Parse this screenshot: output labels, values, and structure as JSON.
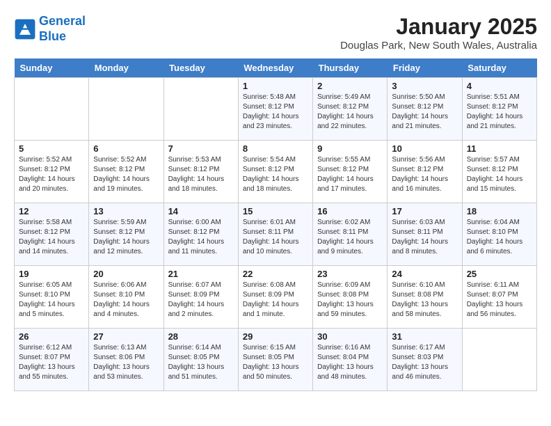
{
  "header": {
    "logo_line1": "General",
    "logo_line2": "Blue",
    "month": "January 2025",
    "location": "Douglas Park, New South Wales, Australia"
  },
  "weekdays": [
    "Sunday",
    "Monday",
    "Tuesday",
    "Wednesday",
    "Thursday",
    "Friday",
    "Saturday"
  ],
  "weeks": [
    [
      {
        "day": "",
        "info": ""
      },
      {
        "day": "",
        "info": ""
      },
      {
        "day": "",
        "info": ""
      },
      {
        "day": "1",
        "info": "Sunrise: 5:48 AM\nSunset: 8:12 PM\nDaylight: 14 hours\nand 23 minutes."
      },
      {
        "day": "2",
        "info": "Sunrise: 5:49 AM\nSunset: 8:12 PM\nDaylight: 14 hours\nand 22 minutes."
      },
      {
        "day": "3",
        "info": "Sunrise: 5:50 AM\nSunset: 8:12 PM\nDaylight: 14 hours\nand 21 minutes."
      },
      {
        "day": "4",
        "info": "Sunrise: 5:51 AM\nSunset: 8:12 PM\nDaylight: 14 hours\nand 21 minutes."
      }
    ],
    [
      {
        "day": "5",
        "info": "Sunrise: 5:52 AM\nSunset: 8:12 PM\nDaylight: 14 hours\nand 20 minutes."
      },
      {
        "day": "6",
        "info": "Sunrise: 5:52 AM\nSunset: 8:12 PM\nDaylight: 14 hours\nand 19 minutes."
      },
      {
        "day": "7",
        "info": "Sunrise: 5:53 AM\nSunset: 8:12 PM\nDaylight: 14 hours\nand 18 minutes."
      },
      {
        "day": "8",
        "info": "Sunrise: 5:54 AM\nSunset: 8:12 PM\nDaylight: 14 hours\nand 18 minutes."
      },
      {
        "day": "9",
        "info": "Sunrise: 5:55 AM\nSunset: 8:12 PM\nDaylight: 14 hours\nand 17 minutes."
      },
      {
        "day": "10",
        "info": "Sunrise: 5:56 AM\nSunset: 8:12 PM\nDaylight: 14 hours\nand 16 minutes."
      },
      {
        "day": "11",
        "info": "Sunrise: 5:57 AM\nSunset: 8:12 PM\nDaylight: 14 hours\nand 15 minutes."
      }
    ],
    [
      {
        "day": "12",
        "info": "Sunrise: 5:58 AM\nSunset: 8:12 PM\nDaylight: 14 hours\nand 14 minutes."
      },
      {
        "day": "13",
        "info": "Sunrise: 5:59 AM\nSunset: 8:12 PM\nDaylight: 14 hours\nand 12 minutes."
      },
      {
        "day": "14",
        "info": "Sunrise: 6:00 AM\nSunset: 8:12 PM\nDaylight: 14 hours\nand 11 minutes."
      },
      {
        "day": "15",
        "info": "Sunrise: 6:01 AM\nSunset: 8:11 PM\nDaylight: 14 hours\nand 10 minutes."
      },
      {
        "day": "16",
        "info": "Sunrise: 6:02 AM\nSunset: 8:11 PM\nDaylight: 14 hours\nand 9 minutes."
      },
      {
        "day": "17",
        "info": "Sunrise: 6:03 AM\nSunset: 8:11 PM\nDaylight: 14 hours\nand 8 minutes."
      },
      {
        "day": "18",
        "info": "Sunrise: 6:04 AM\nSunset: 8:10 PM\nDaylight: 14 hours\nand 6 minutes."
      }
    ],
    [
      {
        "day": "19",
        "info": "Sunrise: 6:05 AM\nSunset: 8:10 PM\nDaylight: 14 hours\nand 5 minutes."
      },
      {
        "day": "20",
        "info": "Sunrise: 6:06 AM\nSunset: 8:10 PM\nDaylight: 14 hours\nand 4 minutes."
      },
      {
        "day": "21",
        "info": "Sunrise: 6:07 AM\nSunset: 8:09 PM\nDaylight: 14 hours\nand 2 minutes."
      },
      {
        "day": "22",
        "info": "Sunrise: 6:08 AM\nSunset: 8:09 PM\nDaylight: 14 hours\nand 1 minute."
      },
      {
        "day": "23",
        "info": "Sunrise: 6:09 AM\nSunset: 8:08 PM\nDaylight: 13 hours\nand 59 minutes."
      },
      {
        "day": "24",
        "info": "Sunrise: 6:10 AM\nSunset: 8:08 PM\nDaylight: 13 hours\nand 58 minutes."
      },
      {
        "day": "25",
        "info": "Sunrise: 6:11 AM\nSunset: 8:07 PM\nDaylight: 13 hours\nand 56 minutes."
      }
    ],
    [
      {
        "day": "26",
        "info": "Sunrise: 6:12 AM\nSunset: 8:07 PM\nDaylight: 13 hours\nand 55 minutes."
      },
      {
        "day": "27",
        "info": "Sunrise: 6:13 AM\nSunset: 8:06 PM\nDaylight: 13 hours\nand 53 minutes."
      },
      {
        "day": "28",
        "info": "Sunrise: 6:14 AM\nSunset: 8:05 PM\nDaylight: 13 hours\nand 51 minutes."
      },
      {
        "day": "29",
        "info": "Sunrise: 6:15 AM\nSunset: 8:05 PM\nDaylight: 13 hours\nand 50 minutes."
      },
      {
        "day": "30",
        "info": "Sunrise: 6:16 AM\nSunset: 8:04 PM\nDaylight: 13 hours\nand 48 minutes."
      },
      {
        "day": "31",
        "info": "Sunrise: 6:17 AM\nSunset: 8:03 PM\nDaylight: 13 hours\nand 46 minutes."
      },
      {
        "day": "",
        "info": ""
      }
    ]
  ]
}
